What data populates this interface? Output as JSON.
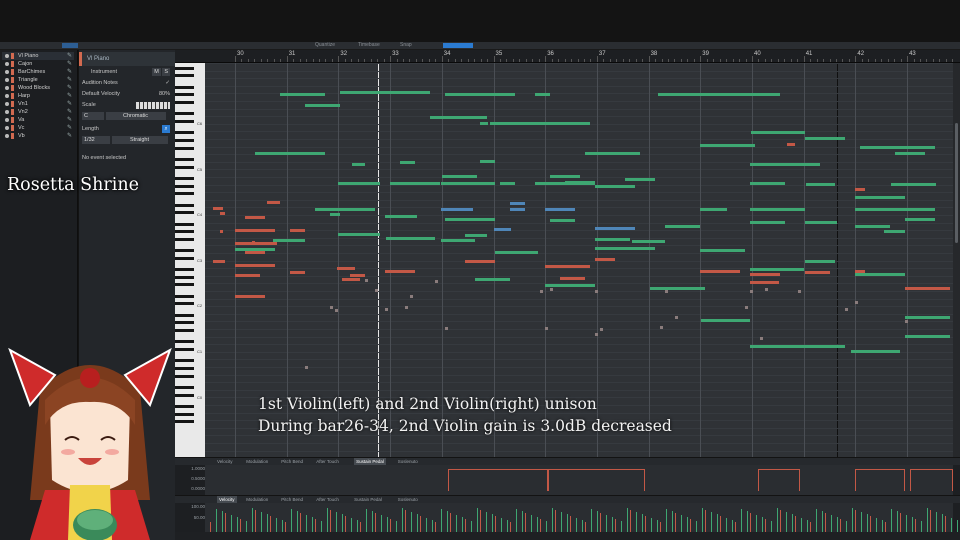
{
  "app": {
    "toolbar": {
      "quantize_label": "Quantize",
      "timebase_label": "Timebase",
      "snap_label": "Snap"
    }
  },
  "tracks": [
    {
      "name": "Vl Piano"
    },
    {
      "name": "Cajon"
    },
    {
      "name": "BarChimes"
    },
    {
      "name": "Triangle"
    },
    {
      "name": "Wood Blocks"
    },
    {
      "name": "Harp"
    },
    {
      "name": "Vn1"
    },
    {
      "name": "Vn2"
    },
    {
      "name": "Va"
    },
    {
      "name": "Vc"
    },
    {
      "name": "Vb"
    }
  ],
  "inspector": {
    "title": "Vl Piano",
    "instrument_label": "Instrument",
    "instrument_m": "M",
    "instrument_s": "S",
    "audition_label": "Audition Notes",
    "default_velocity_label": "Default Velocity",
    "default_velocity_value": "80%",
    "scale_label": "Scale",
    "scale_root": "C",
    "scale_type": "Chromatic",
    "length_label": "Length",
    "length_value": "1/32",
    "length_mode": "Straight",
    "no_event": "No event selected"
  },
  "ruler": {
    "bars": [
      "30",
      "31",
      "32",
      "33",
      "34",
      "35",
      "36",
      "37",
      "38",
      "39",
      "40",
      "41",
      "42",
      "43"
    ]
  },
  "piano": {
    "octave_labels": [
      "C6",
      "C5",
      "C4",
      "C3",
      "C2",
      "C1",
      "C0"
    ]
  },
  "lanes": {
    "upper_tabs": [
      "Velocity",
      "Modulation",
      "Pitch Bend",
      "After Touch",
      "Sustain Pedal",
      "Soslenuto"
    ],
    "upper_active": "Sustain Pedal",
    "upper_values": [
      "1.0000",
      "0.5000",
      "0.0000"
    ],
    "lower_tabs": [
      "Velocity",
      "Modulation",
      "Pitch Bend",
      "After Touch",
      "Sustain Pedal",
      "Soslenuto"
    ],
    "lower_active": "Velocity",
    "lower_values": [
      "100.00",
      "50.00"
    ]
  },
  "overlay": {
    "subtitle_line1": "1st Violin(left) and 2nd Violin(right) unison",
    "subtitle_line2": "During bar26-34, 2nd Violin gain is 3.0dB decreased",
    "brand": "Rosetta Shrine"
  },
  "colors": {
    "violin1_note": "#3ea772",
    "violin2_note": "#c35846",
    "selected_note": "#4f86b8",
    "track_accent": "#d26a50",
    "menu_accent": "#2b7bd1"
  }
}
